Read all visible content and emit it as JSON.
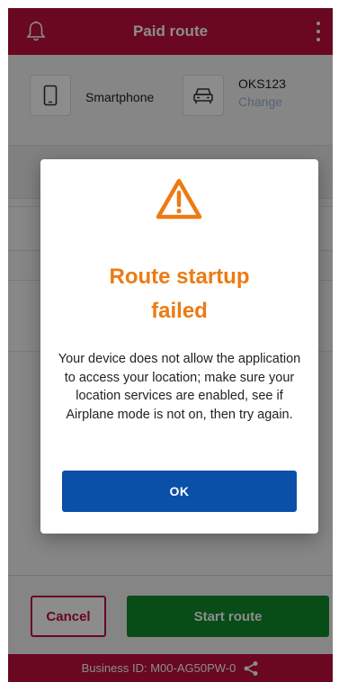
{
  "header": {
    "title": "Paid route",
    "bell_icon": "bell-icon",
    "menu_icon": "kebab-menu-icon"
  },
  "device": {
    "device_label": "Smartphone",
    "plate": "OKS123",
    "change_label": "Change",
    "phone_icon": "smartphone-icon",
    "car_icon": "car-icon"
  },
  "actions": {
    "cancel_label": "Cancel",
    "start_label": "Start route"
  },
  "footer": {
    "business_id": "Business ID:  M00-AG50PW-0",
    "share_icon": "share-icon"
  },
  "dialog": {
    "warning_icon": "warning-triangle-icon",
    "title_line1": "Route startup",
    "title_line2": "failed",
    "message": "Your device does not allow the application to access your location; make sure your location services are enabled, see if Airplane mode is not on, then try again.",
    "ok_label": "OK"
  },
  "colors": {
    "brand": "#c0103b",
    "warning": "#ec7b12",
    "primary_button": "#0a4fa8",
    "start_button": "#0f8a2a"
  }
}
